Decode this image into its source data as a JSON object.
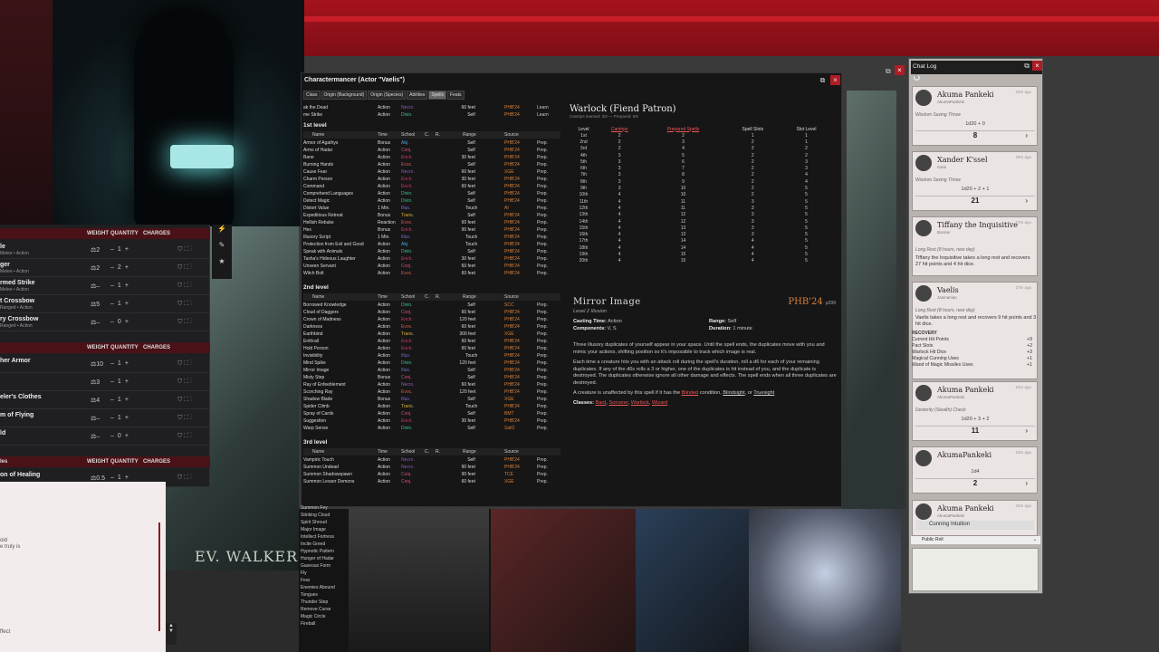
{
  "charactermancer": {
    "title": "Charactermancer (Actor \"Vaelis\")",
    "tabs": [
      "Class",
      "Origin (Background)",
      "Origin (Species)",
      "Abilities",
      "Spells",
      "Feats"
    ],
    "active_tab": "Spells",
    "spell_columns": [
      "Name",
      "Time",
      "School",
      "C.",
      "R.",
      "Range",
      "Source"
    ],
    "top_rows": [
      {
        "name": "ak the Dead",
        "time": "Action",
        "school": "Necro.",
        "range": "60 feet",
        "source": "PHB'24",
        "prep": "Learn"
      },
      {
        "name": "me Strike",
        "time": "Action",
        "school": "Divin.",
        "range": "Self",
        "source": "PHB'24",
        "prep": "Learn"
      }
    ],
    "levels": [
      {
        "label": "1st level",
        "rows": [
          {
            "name": "Armor of Agathys",
            "time": "Bonus",
            "school": "Abj.",
            "range": "Self",
            "source": "PHB'24",
            "prep": "Prep."
          },
          {
            "name": "Arms of Hadar",
            "time": "Action",
            "school": "Conj.",
            "range": "Self",
            "source": "PHB'24",
            "prep": "Prep."
          },
          {
            "name": "Bane",
            "time": "Action",
            "school": "Ench.",
            "range": "30 feet",
            "source": "PHB'24",
            "prep": "Prep."
          },
          {
            "name": "Burning Hands",
            "time": "Action",
            "school": "Evoc.",
            "range": "Self",
            "source": "PHB'24",
            "prep": "Prep."
          },
          {
            "name": "Cause Fear",
            "time": "Action",
            "school": "Necro.",
            "range": "60 feet",
            "source": "XGE",
            "prep": "Prep."
          },
          {
            "name": "Charm Person",
            "time": "Action",
            "school": "Ench.",
            "range": "30 feet",
            "source": "PHB'24",
            "prep": "Prep."
          },
          {
            "name": "Command",
            "time": "Action",
            "school": "Ench.",
            "range": "60 feet",
            "source": "PHB'24",
            "prep": "Prep."
          },
          {
            "name": "Comprehend Languages",
            "time": "Action",
            "school": "Divin.",
            "range": "Self",
            "source": "PHB'24",
            "prep": "Prep."
          },
          {
            "name": "Detect Magic",
            "time": "Action",
            "school": "Divin.",
            "range": "Self",
            "source": "PHB'24",
            "prep": "Prep."
          },
          {
            "name": "Distort Value",
            "time": "1 Min.",
            "school": "Illus.",
            "range": "Touch",
            "source": "AI",
            "prep": "Prep."
          },
          {
            "name": "Expeditious Retreat",
            "time": "Bonus",
            "school": "Trans.",
            "range": "Self",
            "source": "PHB'24",
            "prep": "Prep."
          },
          {
            "name": "Hellish Rebuke",
            "time": "Reaction",
            "school": "Evoc.",
            "range": "60 feet",
            "source": "PHB'24",
            "prep": "Prep."
          },
          {
            "name": "Hex",
            "time": "Bonus",
            "school": "Ench.",
            "range": "90 feet",
            "source": "PHB'24",
            "prep": "Prep."
          },
          {
            "name": "Illusory Script",
            "time": "1 Min.",
            "school": "Illus.",
            "range": "Touch",
            "source": "PHB'24",
            "prep": "Prep."
          },
          {
            "name": "Protection from Evil and Good",
            "time": "Action",
            "school": "Abj.",
            "range": "Touch",
            "source": "PHB'24",
            "prep": "Prep."
          },
          {
            "name": "Speak with Animals",
            "time": "Action",
            "school": "Divin.",
            "range": "Self",
            "source": "PHB'24",
            "prep": "Prep."
          },
          {
            "name": "Tasha's Hideous Laughter",
            "time": "Action",
            "school": "Ench.",
            "range": "30 feet",
            "source": "PHB'24",
            "prep": "Prep."
          },
          {
            "name": "Unseen Servant",
            "time": "Action",
            "school": "Conj.",
            "range": "60 feet",
            "source": "PHB'24",
            "prep": "Prep."
          },
          {
            "name": "Witch Bolt",
            "time": "Action",
            "school": "Evoc.",
            "range": "60 feet",
            "source": "PHB'24",
            "prep": "Prep."
          }
        ]
      },
      {
        "label": "2nd level",
        "rows": [
          {
            "name": "Borrowed Knowledge",
            "time": "Action",
            "school": "Divin.",
            "range": "Self",
            "source": "SCC",
            "prep": "Prep."
          },
          {
            "name": "Cloud of Daggers",
            "time": "Action",
            "school": "Conj.",
            "range": "60 feet",
            "source": "PHB'24",
            "prep": "Prep."
          },
          {
            "name": "Crown of Madness",
            "time": "Action",
            "school": "Ench.",
            "range": "120 feet",
            "source": "PHB'24",
            "prep": "Prep."
          },
          {
            "name": "Darkness",
            "time": "Action",
            "school": "Evoc.",
            "range": "60 feet",
            "source": "PHB'24",
            "prep": "Prep."
          },
          {
            "name": "Earthbind",
            "time": "Action",
            "school": "Trans.",
            "range": "300 feet",
            "source": "XGE",
            "prep": "Prep."
          },
          {
            "name": "Enthrall",
            "time": "Action",
            "school": "Ench.",
            "range": "60 feet",
            "source": "PHB'24",
            "prep": "Prep."
          },
          {
            "name": "Hold Person",
            "time": "Action",
            "school": "Ench.",
            "range": "60 feet",
            "source": "PHB'24",
            "prep": "Prep."
          },
          {
            "name": "Invisibility",
            "time": "Action",
            "school": "Illus.",
            "range": "Touch",
            "source": "PHB'24",
            "prep": "Prep."
          },
          {
            "name": "Mind Spike",
            "time": "Action",
            "school": "Divin.",
            "range": "120 feet",
            "source": "PHB'24",
            "prep": "Prep."
          },
          {
            "name": "Mirror Image",
            "time": "Action",
            "school": "Illus.",
            "range": "Self",
            "source": "PHB'24",
            "prep": "Prep."
          },
          {
            "name": "Misty Step",
            "time": "Bonus",
            "school": "Conj.",
            "range": "Self",
            "source": "PHB'24",
            "prep": "Prep."
          },
          {
            "name": "Ray of Enfeeblement",
            "time": "Action",
            "school": "Necro.",
            "range": "60 feet",
            "source": "PHB'24",
            "prep": "Prep."
          },
          {
            "name": "Scorching Ray",
            "time": "Action",
            "school": "Evoc.",
            "range": "120 feet",
            "source": "PHB'24",
            "prep": "Prep."
          },
          {
            "name": "Shadow Blade",
            "time": "Bonus",
            "school": "Illus.",
            "range": "Self",
            "source": "XGE",
            "prep": "Prep."
          },
          {
            "name": "Spider Climb",
            "time": "Action",
            "school": "Trans.",
            "range": "Touch",
            "source": "PHB'24",
            "prep": "Prep."
          },
          {
            "name": "Spray of Cards",
            "time": "Action",
            "school": "Conj.",
            "range": "Self",
            "source": "BMT",
            "prep": "Prep."
          },
          {
            "name": "Suggestion",
            "time": "Action",
            "school": "Ench.",
            "range": "30 feet",
            "source": "PHB'24",
            "prep": "Prep."
          },
          {
            "name": "Warp Sense",
            "time": "Action",
            "school": "Divin.",
            "range": "Self",
            "source": "SatO",
            "prep": "Prep."
          }
        ]
      },
      {
        "label": "3rd level",
        "rows": [
          {
            "name": "Vampiric Touch",
            "time": "Action",
            "school": "Necro.",
            "range": "Self",
            "source": "PHB'24",
            "prep": "Prep."
          },
          {
            "name": "Summon Undead",
            "time": "Action",
            "school": "Necro.",
            "range": "90 feet",
            "source": "PHB'24",
            "prep": "Prep."
          },
          {
            "name": "Summon Shadowspawn",
            "time": "Action",
            "school": "Conj.",
            "range": "90 feet",
            "source": "TCE",
            "prep": "Prep."
          },
          {
            "name": "Summon Lesser Demons",
            "time": "Action",
            "school": "Conj.",
            "range": "60 feet",
            "source": "XGE",
            "prep": "Prep."
          }
        ]
      }
    ],
    "extra_names": [
      "Summon Fey",
      "Stinking Cloud",
      "Spirit Shroud",
      "Major Image",
      "Intellect Fortress",
      "Incite Greed",
      "Hypnotic Pattern",
      "Hunger of Hadar",
      "Gaseous Form",
      "Fly",
      "Fear",
      "Enemies Abound",
      "Tongues",
      "Thunder Step",
      "Remove Curse",
      "Magic Circle",
      "Fireball"
    ],
    "class_panel": {
      "title": "Warlock (Fiend Patron)",
      "subtitle": "Cantrips learned: 3/3 — Prepared: 5/5",
      "columns": [
        "Level",
        "Cantrips",
        "Prepared Spells",
        "Spell Slots",
        "Slot Level"
      ],
      "rows": [
        [
          "1st",
          "2",
          "2",
          "1",
          "1"
        ],
        [
          "2nd",
          "2",
          "3",
          "2",
          "1"
        ],
        [
          "3rd",
          "2",
          "4",
          "2",
          "2"
        ],
        [
          "4th",
          "3",
          "5",
          "2",
          "2"
        ],
        [
          "5th",
          "3",
          "6",
          "2",
          "3"
        ],
        [
          "6th",
          "3",
          "7",
          "2",
          "3"
        ],
        [
          "7th",
          "3",
          "8",
          "2",
          "4"
        ],
        [
          "8th",
          "3",
          "9",
          "2",
          "4"
        ],
        [
          "9th",
          "3",
          "10",
          "2",
          "5"
        ],
        [
          "10th",
          "4",
          "10",
          "2",
          "5"
        ],
        [
          "11th",
          "4",
          "11",
          "3",
          "5"
        ],
        [
          "12th",
          "4",
          "11",
          "3",
          "5"
        ],
        [
          "13th",
          "4",
          "12",
          "3",
          "5"
        ],
        [
          "14th",
          "4",
          "12",
          "3",
          "5"
        ],
        [
          "15th",
          "4",
          "13",
          "3",
          "5"
        ],
        [
          "16th",
          "4",
          "13",
          "3",
          "5"
        ],
        [
          "17th",
          "4",
          "14",
          "4",
          "5"
        ],
        [
          "18th",
          "4",
          "14",
          "4",
          "5"
        ],
        [
          "19th",
          "4",
          "15",
          "4",
          "5"
        ],
        [
          "20th",
          "4",
          "15",
          "4",
          "5"
        ]
      ]
    },
    "spell_detail": {
      "name": "Mirror Image",
      "source": "PHB'24",
      "page": "p299",
      "level": "Level 2 Illusion",
      "casting_time_label": "Casting Time:",
      "casting_time": "Action",
      "range_label": "Range:",
      "range": "Self",
      "components_label": "Components:",
      "components": "V, S",
      "duration_label": "Duration:",
      "duration": "1 minute",
      "p1": "Three illusory duplicates of yourself appear in your space. Until the spell ends, the duplicates move with you and mimic your actions, shifting position so it's impossible to track which image is real.",
      "p2": "Each time a creature hits you with an attack roll during the spell's duration, roll a d6 for each of your remaining duplicates. If any of the d6s rolls a 3 or higher, one of the duplicates is hit instead of you, and the duplicate is destroyed. The duplicates otherwise ignore all other damage and effects. The spell ends when all three duplicates are destroyed.",
      "p3a": "A creature is unaffected by this spell if it has the",
      "p3_blinded": "Blinded",
      "p3b": "condition,",
      "p3_blindsight": "Blindsight",
      "p3c": ", or",
      "p3_truesight": "Truesight",
      "classes_label": "Classes:",
      "classes": [
        "Bard",
        "Sorcerer",
        "Warlock",
        "Wizard"
      ]
    }
  },
  "inventory": {
    "headers": [
      "WEIGHT",
      "QUANTITY",
      "CHARGES"
    ],
    "sections": [
      {
        "items": [
          {
            "name": "le",
            "sub": "Melee • Action",
            "w": "2",
            "q": "1"
          },
          {
            "name": "ger",
            "sub": "Melee • Action",
            "w": "2",
            "q": "2"
          },
          {
            "name": "rmed Strike",
            "sub": "Melee • Action",
            "w": "–",
            "q": "1"
          },
          {
            "name": "t Crossbow",
            "sub": "Ranged • Action",
            "w": "5",
            "q": "1"
          },
          {
            "name": "ry Crossbow",
            "sub": "Ranged • Action",
            "w": "–",
            "q": "0"
          }
        ]
      },
      {
        "items": [
          {
            "name": "her Armor",
            "sub": "",
            "w": "10",
            "q": "1"
          },
          {
            "name": "",
            "sub": "",
            "w": "3",
            "q": "1"
          },
          {
            "name": "eler's Clothes",
            "sub": "",
            "w": "4",
            "q": "1"
          },
          {
            "name": "m of Flying",
            "sub": "",
            "w": "–",
            "q": "1"
          },
          {
            "name": "ld",
            "sub": "",
            "w": "–",
            "q": "0"
          }
        ]
      },
      {
        "items": [
          {
            "name": "on of Healing",
            "sub": "",
            "w": "0.5",
            "q": "1"
          }
        ]
      }
    ],
    "section3_title": "les"
  },
  "note": {
    "lines": [
      "oid",
      "e truly is"
    ],
    "footer": "ffect"
  },
  "art_signature": "EV. WALKER",
  "chat": {
    "title": "Chat Log",
    "badge": "6",
    "messages": [
      {
        "who": "Akuma Pankeki",
        "acct": "AkumaPankeki",
        "time": "29m ago",
        "kind": "Wisdom Saving Throw",
        "formula": "1d20 + 0",
        "result": "8"
      },
      {
        "who": "Xander K'ssel",
        "acct": "Kami",
        "time": "29m ago",
        "kind": "Wisdom Saving Throw",
        "formula": "1d20 + 2 + 1",
        "result": "21"
      },
      {
        "who": "Tiffany the Inquisitive",
        "acct": "Bonnie",
        "time": "27m ago",
        "kind": "Long Rest (8 hours, new day)",
        "body": "Tiffany the Inquisitive takes a long rest and recovers 27 hit points and 4 hit dice."
      },
      {
        "who": "Vaelis",
        "acct": "Jasmanian",
        "time": "27m ago",
        "kind": "Long Rest (8 hours, new day)",
        "body": "Vaelis takes a long rest and recovers 9 hit points and 3 hit dice."
      },
      {
        "who": "Akuma Pankeki",
        "acct": "AkumaPankeki",
        "time": "24m ago",
        "kind": "Dexterity (Stealth) Check",
        "formula": "1d20 + 3 + 2",
        "result": "11"
      },
      {
        "who": "AkumaPankeki",
        "acct": "",
        "time": "23m ago",
        "kind": "",
        "formula": "1d4",
        "result": "2"
      },
      {
        "who": "Akuma Pankeki",
        "acct": "AkumaPankeki",
        "time": "22m ago",
        "kind": "",
        "formula": "",
        "result": ""
      }
    ],
    "recovery": {
      "label": "RECOVERY",
      "rows": [
        [
          "Current Hit Points",
          "+9"
        ],
        [
          "Pact Slots",
          "+2"
        ],
        [
          "Warlock Hit Dice",
          "+3"
        ],
        [
          "Magical Cunning Uses",
          "+1"
        ],
        [
          "Wand of Magic Missiles Uses",
          "+1"
        ]
      ]
    },
    "bottom_item": "Cunning Intuition",
    "roll_mode": "Public Roll"
  }
}
